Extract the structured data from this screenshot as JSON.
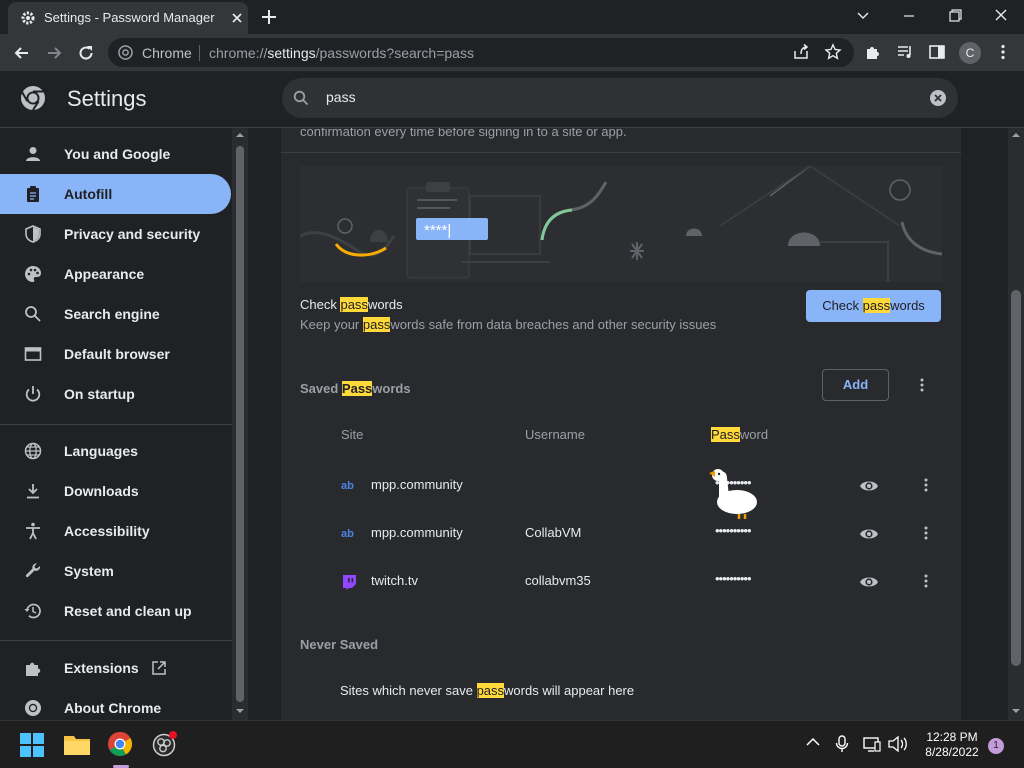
{
  "browser": {
    "tab_title": "Settings - Password Manager",
    "omnibox_chip": "Chrome",
    "url_scheme": "chrome://",
    "url_host": "settings",
    "url_path": "/passwords?search=pass",
    "profile_initial": "C"
  },
  "header": {
    "title": "Settings",
    "search_value": "pass"
  },
  "sidebar": {
    "items": [
      {
        "label": "You and Google",
        "icon": "person-icon"
      },
      {
        "label": "Autofill",
        "icon": "clipboard-icon"
      },
      {
        "label": "Privacy and security",
        "icon": "shield-icon"
      },
      {
        "label": "Appearance",
        "icon": "palette-icon"
      },
      {
        "label": "Search engine",
        "icon": "search-icon"
      },
      {
        "label": "Default browser",
        "icon": "browser-icon"
      },
      {
        "label": "On startup",
        "icon": "power-icon"
      },
      {
        "label": "Languages",
        "icon": "globe-icon"
      },
      {
        "label": "Downloads",
        "icon": "download-icon"
      },
      {
        "label": "Accessibility",
        "icon": "accessibility-icon"
      },
      {
        "label": "System",
        "icon": "wrench-icon"
      },
      {
        "label": "Reset and clean up",
        "icon": "history-icon"
      },
      {
        "label": "Extensions",
        "icon": "puzzle-icon"
      },
      {
        "label": "About Chrome",
        "icon": "chrome-icon"
      }
    ]
  },
  "main": {
    "confirm_text": "confirmation every time before signing in to a site or app.",
    "illustration_password": "****|",
    "check": {
      "title_pre": "Check ",
      "title_hl": "pass",
      "title_post": "words",
      "desc_pre": "Keep your ",
      "desc_hl": "pass",
      "desc_post": "words safe from data breaches and other security issues",
      "button_pre": "Check ",
      "button_hl": "pass",
      "button_post": "words"
    },
    "saved": {
      "title_pre": "Saved ",
      "title_hl": "Pass",
      "title_post": "words",
      "add_label": "Add",
      "col_site": "Site",
      "col_username": "Username",
      "col_password_hl": "Pass",
      "col_password_post": "word",
      "rows": [
        {
          "site": "mpp.community",
          "username": "",
          "password": "••••••••••",
          "favicon": "ab-icon"
        },
        {
          "site": "mpp.community",
          "username": "CollabVM",
          "password": "••••••••••",
          "favicon": "ab-icon"
        },
        {
          "site": "twitch.tv",
          "username": "collabvm35",
          "password": "••••••••••",
          "favicon": "twitch-icon"
        }
      ]
    },
    "never_saved": {
      "title": "Never Saved",
      "desc_pre": "Sites which never save ",
      "desc_hl": "pass",
      "desc_post": "words will appear here"
    }
  },
  "taskbar": {
    "time": "12:28 PM",
    "date": "8/28/2022",
    "notification_count": "1"
  },
  "colors": {
    "accent": "#8ab4f8",
    "highlight": "#ffd83a",
    "background": "#202124",
    "card": "#292a2d"
  }
}
